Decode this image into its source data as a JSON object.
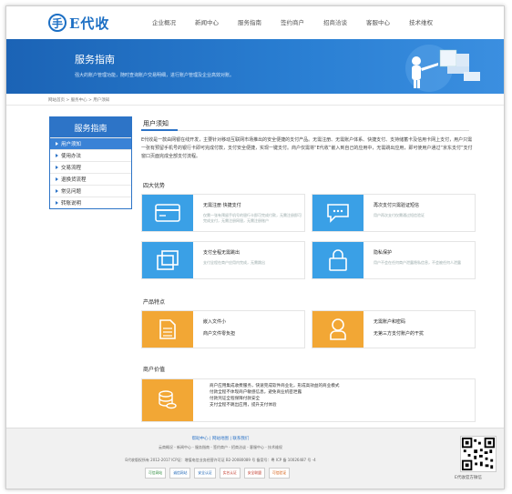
{
  "header": {
    "logo_text": "E代收",
    "logo_mark": "手",
    "nav": [
      "企业概况",
      "新闻中心",
      "服务指南",
      "签约商户",
      "招商洽谈",
      "客服中心",
      "技术维权"
    ]
  },
  "banner": {
    "title": "服务指南",
    "subtitle": "强大的账户管理功能，随时查询账户交易明细，进行账户管理及企业高效对账。"
  },
  "breadcrumb": "网站首页 > 服务中心 > 用户须知",
  "sidebar": {
    "title": "服务指南",
    "items": [
      {
        "label": "用户须知",
        "active": true
      },
      {
        "label": "使用办法",
        "active": false
      },
      {
        "label": "交易流程",
        "active": false
      },
      {
        "label": "退换货流程",
        "active": false
      },
      {
        "label": "常见问题",
        "active": false
      },
      {
        "label": "转账说明",
        "active": false
      }
    ]
  },
  "main": {
    "title": "用户须知",
    "intro": "E代收是一款由网银在线开发，主要针对移动互联网市场推出的安全便捷的支付产品。无需注册、无需账户体系、快捷支付、支持储蓄卡及信用卡网上支付，用户只需一张有预留手机号的银行卡即可完成付款，支付安全便捷，实现一键支付。商户仅需将“E代收”嵌入到自己的应用中，无需跳出应用，即可使用户通过“京东支付”支付窗口页面完成全部支付流程。",
    "advantages_title": "四大优势",
    "advantages": [
      {
        "icon": "card-icon",
        "title": "无需注册 快捷支付",
        "desc": "仅需一张有预留手机号的银行卡即可完成付款，无需注册即可完成支付，无需注册网银，无需注册账户"
      },
      {
        "icon": "message-icon",
        "title": "再次支付只需验证短信",
        "desc": "用户再次支付仅需通过短信验证"
      },
      {
        "icon": "window-icon",
        "title": "支付全程无需跳出",
        "desc": "支付全程在商户应用内完成，无需跳出"
      },
      {
        "icon": "lock-icon",
        "title": "隐私保护",
        "desc": "用户不会在任何商户泄露隐私信息，不会被任何人泄露"
      }
    ],
    "features_title": "产品特点",
    "features": [
      {
        "icon": "document-icon",
        "title": "嵌入文件小",
        "desc": "商户文件零负担"
      },
      {
        "icon": "user-icon",
        "title": "无需账户和密码",
        "desc": "无第三方支付账户的干扰"
      }
    ],
    "value_title": "商户价值",
    "value_lines": [
      "商户应用集成收费服务，快速完成软件商业化，形成高效益的商业模式",
      "付款全程不体现商户敏感信息，避免商业机密泄露",
      "付款凭证全程保障付款安全",
      "支付全程不跳出应用，提升支付体验"
    ]
  },
  "footer": {
    "links": "帮助中心  |  网站地图  |  联系我们",
    "nav_line": "云商概况 - 新闻中心 - 服务指南 - 签约商户 - 招商洽谈 - 客服中心 - 技术维权",
    "copyright": "E代收版权所有 2012-2017 ICP证：增值电信业务经营许可证 B2-20080089 号 备案号：粤 ICP 备 10026487 号 -4",
    "badges": [
      "可信网站",
      "诚信网站",
      "安全认证",
      "实名认证",
      "安全联盟",
      "可信验证"
    ],
    "qr_label": "E代收官方微信"
  },
  "colors": {
    "brand": "#2d74c7",
    "card_blue": "#3aa0e6",
    "card_orange": "#f2a735"
  }
}
